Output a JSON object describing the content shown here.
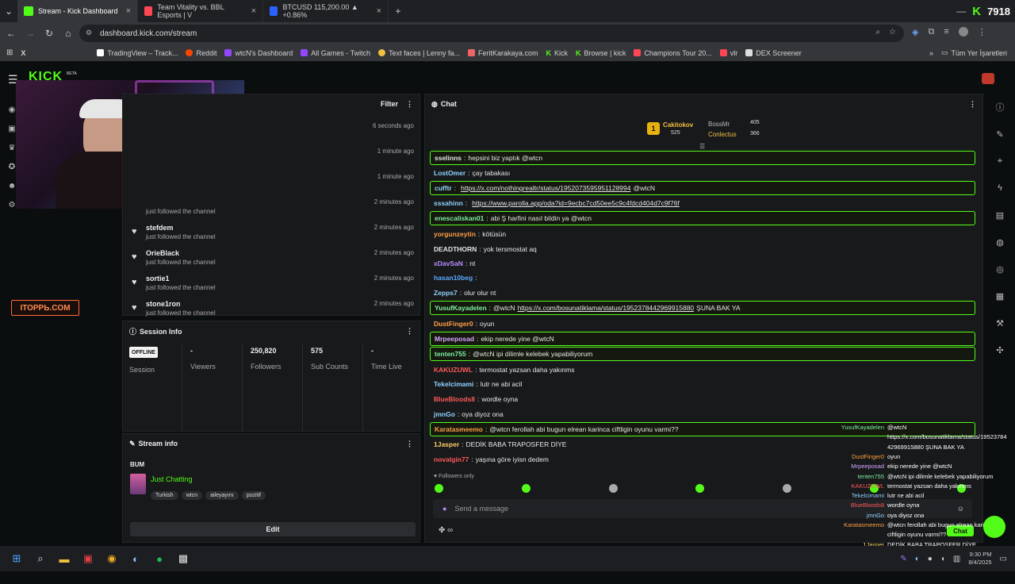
{
  "browser": {
    "tabs": [
      {
        "label": "Stream - Kick Dashboard",
        "color": "#53fc18"
      },
      {
        "label": "Team Vitality vs. BBL Esports | V",
        "color": "#ff4655"
      },
      {
        "label": "BTCUSD 115,200.00 ▲ +0.86%",
        "color": "#2962ff"
      }
    ],
    "watermark": "7918",
    "url": "dashboard.kick.com/stream",
    "bookmarks": [
      "TradingView – Track...",
      "Reddit",
      "wtcN's Dashboard",
      "All Games - Twitch",
      "Text faces | Lenny fa...",
      "FeritKarakaya.com",
      "Kick",
      "Browse | kick",
      "Champions Tour 20...",
      "vlr",
      "DEX Screener"
    ],
    "all_bookmarks": "Tüm Yer İşaretleri"
  },
  "kick_logo": "KICK",
  "beta": "BETA",
  "overlay_logo": "IТОРРЬ.COM",
  "activity": {
    "filter_label": "Filter",
    "rows": [
      {
        "name": "",
        "sub": "",
        "time": "6 seconds ago"
      },
      {
        "name": "",
        "sub": "",
        "time": "1 minute ago"
      },
      {
        "name": "",
        "sub": "",
        "time": "1 minute ago"
      },
      {
        "name": "",
        "sub": "just followed the channel",
        "time": "2 minutes ago"
      },
      {
        "name": "stefdem",
        "sub": "just followed the channel",
        "time": "2 minutes ago"
      },
      {
        "name": "OrieBlack",
        "sub": "just followed the channel",
        "time": "2 minutes ago"
      },
      {
        "name": "sortie1",
        "sub": "just followed the channel",
        "time": "2 minutes ago"
      },
      {
        "name": "stone1ron",
        "sub": "just followed the channel",
        "time": "2 minutes ago"
      }
    ]
  },
  "session": {
    "title": "Session Info",
    "status": "OFFLINE",
    "status_label": "Session",
    "stats": [
      {
        "value": "-",
        "label": "Viewers"
      },
      {
        "value": "250,820",
        "label": "Followers"
      },
      {
        "value": "575",
        "label": "Sub Counts"
      },
      {
        "value": "-",
        "label": "Time Live"
      }
    ]
  },
  "stream_info": {
    "title": "Stream info",
    "stream_title": "BUM",
    "category": "Just Chatting",
    "tags": [
      "Turkish",
      "wtcn",
      "aileyayını",
      "pozitif"
    ],
    "edit_label": "Edit"
  },
  "chat": {
    "title": "Chat",
    "top_gifters": [
      {
        "name": "Cakitokov",
        "count": "525",
        "rank": "1"
      },
      {
        "name": "BossMr",
        "count": "405"
      },
      {
        "name": "Conlectus",
        "count": "366"
      }
    ],
    "messages": [
      {
        "user": "sselinns",
        "color": "#e6e6e6",
        "text": "hepsini biz yaptık @wtcn",
        "hl": true
      },
      {
        "user": "LostOmer",
        "color": "#8fd3ff",
        "text": "çay tabakası",
        "hl": false
      },
      {
        "user": "cufftr",
        "color": "#8fd3ff",
        "link": "https://x.com/nothingrealtr/status/1952073595951128994",
        "text": "@wtcN",
        "hl": true
      },
      {
        "user": "sssahinn",
        "color": "#8fd3ff",
        "link": "https://www.parolla.app/oda?id=9ecbc7cd50ee5c9c4fdcd404d7c9f76f",
        "text": "",
        "hl": false
      },
      {
        "user": "enescaliskan01",
        "color": "#7ef0a0",
        "text": "abi Ş harfini nasıl bildin ya @wtcn",
        "hl": true
      },
      {
        "user": "yorgunzeytin",
        "color": "#ff9f43",
        "text": "kötüsün",
        "hl": false
      },
      {
        "user": "DEADTHORN",
        "color": "#e6e6e6",
        "text": "yok tersmostat aq",
        "hl": false
      },
      {
        "user": "xDavSaN",
        "color": "#b98cff",
        "text": "nt",
        "hl": false
      },
      {
        "user": "hasan10beg",
        "color": "#5aa9ff",
        "text": "",
        "hl": false
      },
      {
        "user": "Zepps7",
        "color": "#8fd3ff",
        "text": "olur olur nt",
        "hl": false
      },
      {
        "user": "YusufKayadelen",
        "color": "#7ef0a0",
        "text": "@wtcN",
        "link": "https://x.com/bosunatiklama/status/1952378442969915880",
        "text2": "ŞUNA BAK YA",
        "hl": true
      },
      {
        "user": "DustFinger0",
        "color": "#ff9f43",
        "text": "oyun",
        "hl": false
      },
      {
        "user": "Mrpeeposad",
        "color": "#d7a6ff",
        "text": "ekip nerede yine @wtcN",
        "hl": true
      },
      {
        "user": "tenten755",
        "color": "#7ef0a0",
        "text": "@wtcN ipi dilimle kelebek yapabiliyorum",
        "hl": true
      },
      {
        "user": "KAKUZUWL",
        "color": "#ff5a5a",
        "text": "termostat yazsan daha yakınms",
        "hl": false
      },
      {
        "user": "Tekelcimami",
        "color": "#8fd3ff",
        "text": "lutr ne abi acil",
        "hl": false
      },
      {
        "user": "BlueBloods8",
        "color": "#ff5a5a",
        "text": "wordle oyna",
        "hl": false
      },
      {
        "user": "jmnGo",
        "color": "#8fd3ff",
        "text": "oya diyoz ona",
        "hl": false
      },
      {
        "user": "Karatasmeemo",
        "color": "#ff9f43",
        "text": "@wtcn ferollah abi bugun elrean karinca ciftligin oyunu varmi??",
        "hl": true
      },
      {
        "user": "1Jasper",
        "color": "#ffd166",
        "text": "DEDİK BABA TRAPOSFER DİYE",
        "hl": false
      },
      {
        "user": "novalgin77",
        "color": "#ff5a5a",
        "text": "yaşına göre iyisn dedem",
        "hl": false
      }
    ],
    "followers_only": "Followers only",
    "send_placeholder": "Send a message",
    "chat_button": "Chat"
  },
  "overlay_chat": [
    {
      "user": "YusufKayadelen",
      "color": "#7ef0a0",
      "text": "@wtcN"
    },
    {
      "user": "",
      "color": "#ffffff",
      "text": "https://x.com/bosunatiklama/status/19523784"
    },
    {
      "user": "",
      "color": "#ffffff",
      "text": "42969915880 ŞUNA BAK YA"
    },
    {
      "user": "DustFinger0",
      "color": "#ff9f43",
      "text": "oyun"
    },
    {
      "user": "Mrpeeposad",
      "color": "#d7a6ff",
      "text": "ekip nerede yine @wtcN"
    },
    {
      "user": "tenten755",
      "color": "#7ef0a0",
      "text": "@wtcN ipi dilimle kelebek yapabiliyorum"
    },
    {
      "user": "KAKUZUWL",
      "color": "#ff5a5a",
      "text": "termostat yazsan daha yakınms"
    },
    {
      "user": "Tekelcimami",
      "color": "#8fd3ff",
      "text": "lutr ne abi acil"
    },
    {
      "user": "BlueBloods8",
      "color": "#ff5a5a",
      "text": "wordle oyna"
    },
    {
      "user": "jmnGo",
      "color": "#8fd3ff",
      "text": "oya diyoz ona"
    },
    {
      "user": "Karatasmeemo",
      "color": "#ff9f43",
      "text": "@wtcn ferollah abi bugun elrean karinca"
    },
    {
      "user": "",
      "color": "#ffffff",
      "text": "ciftligin oyunu varmi??"
    },
    {
      "user": "1Jasper",
      "color": "#ffd166",
      "text": "DEDİK BABA TRAPOSFER DİYE"
    }
  ],
  "taskbar": {
    "time": "9:30 PM",
    "date": "8/4/2025"
  }
}
